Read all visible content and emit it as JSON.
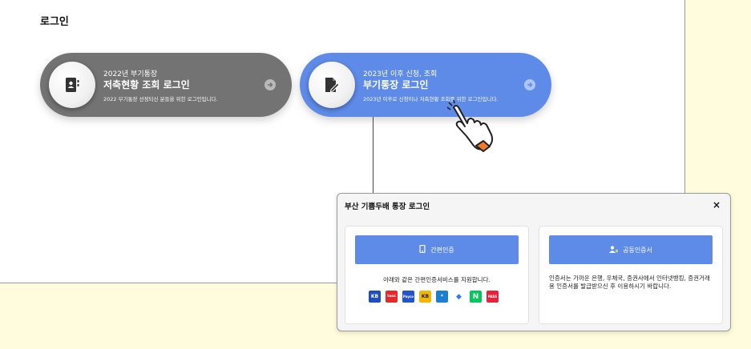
{
  "section_title": "로그인",
  "pills": [
    {
      "sub": "2022년 부기통장",
      "main": "저축현황 조회 로그인",
      "desc": "2022 부기통장 선정되신 분들을 위한 로그인입니다.",
      "color": "#737373",
      "icon": "contact-book-icon"
    },
    {
      "sub": "2023년 이후 신청, 조회",
      "main": "부기통장 로그인",
      "desc": "2023년 이후로 신청이나 저축현황 조회를 위한 로그인입니다.",
      "color": "#5e8be8",
      "icon": "document-edit-icon"
    }
  ],
  "modal": {
    "title": "부산 기쁨두배 통장 로그인",
    "close": "×",
    "simple_auth": {
      "button_label": "간편인증",
      "info": "아래와 같은 간편인증서비스를 지원합니다.",
      "providers": [
        {
          "name": "KB",
          "color": "#1f4fbf"
        },
        {
          "name": "toss",
          "color": "#e8262b"
        },
        {
          "name": "Payco",
          "color": "#2454c7"
        },
        {
          "name": "KB",
          "color": "#f2b705"
        },
        {
          "name": "*",
          "color": "#1a7fd0"
        },
        {
          "name": "◆",
          "color": "#2979ff"
        },
        {
          "name": "N",
          "color": "#03c75a"
        },
        {
          "name": "PASS",
          "color": "#e5243b"
        }
      ]
    },
    "cert_auth": {
      "button_label": "공동인증서",
      "info": "인증서는 가까운 은행, 우체국, 증권사에서 인터넷뱅킹, 증권거래용 인증서를 발급받으신 후 이용하시기 바랍니다."
    }
  },
  "colors": {
    "accent": "#5e8be8",
    "background_yellow": "#fffbdd"
  }
}
